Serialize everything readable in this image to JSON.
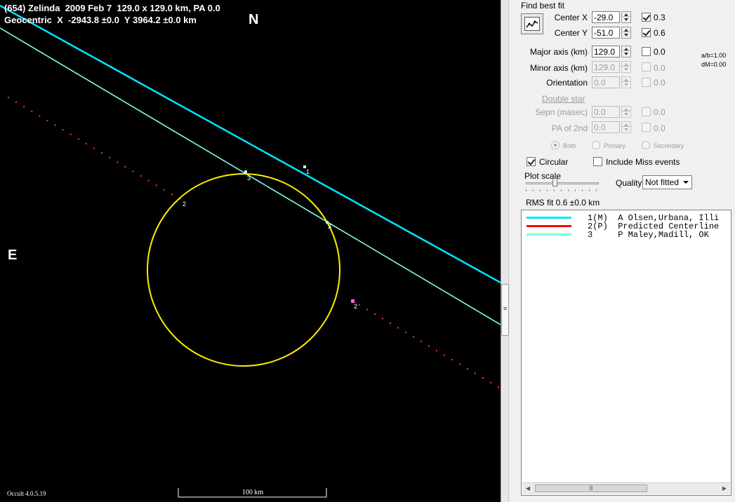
{
  "plot": {
    "title_line1": "(654) Zelinda  2009 Feb 7  129.0 x 129.0 km, PA 0.0",
    "title_line2": "Geocentric  X  -2943.8 ±0.0  Y 3964.2 ±0.0 km",
    "north_label": "N",
    "east_label": "E",
    "version": "Occult 4.0.5.19",
    "scale_label": "100 km",
    "chord_labels": [
      "1",
      "2",
      "3",
      "2",
      "3"
    ],
    "colors": {
      "chord1": "#00e5ff",
      "chord2": "#ff3030",
      "chord3": "#7fffd4",
      "ellipse": "#ffee00",
      "background": "#000000"
    }
  },
  "panel": {
    "group_title": "Find best fit",
    "fit_button_icon": "fit-chart-icon",
    "center_x": {
      "label": "Center X",
      "value": "-29.0",
      "checked": true,
      "uncertainty": "0.3"
    },
    "center_y": {
      "label": "Center Y",
      "value": "-51.0",
      "checked": true,
      "uncertainty": "0.6"
    },
    "major_axis": {
      "label": "Major axis (km)",
      "value": "129.0",
      "checked": false,
      "uncertainty": "0.0"
    },
    "minor_axis": {
      "label": "Minor axis (km)",
      "value": "129.0",
      "checked": false,
      "uncertainty": "0.0"
    },
    "orientation": {
      "label": "Orientation",
      "value": "0.0",
      "checked": false,
      "uncertainty": "0.0"
    },
    "ratio_ab": "a/b=1.00",
    "ratio_dm": "dM=0.00",
    "double_star_label": "Double star",
    "sepn": {
      "label": "Sepn (masec)",
      "value": "0.0",
      "checked": false,
      "uncertainty": "0.0"
    },
    "pa_2nd": {
      "label": "PA of 2nd",
      "value": "0.0",
      "checked": false,
      "uncertainty": "0.0"
    },
    "radio_both": "Both",
    "radio_primary": "Primary",
    "radio_secondary": "Secondary",
    "circular_label": "Circular",
    "circular_checked": true,
    "include_miss_label": "Include Miss events",
    "include_miss_checked": false,
    "plot_scale_label": "Plot scale",
    "quality_label": "Quality",
    "quality_value": "Not fitted",
    "rms_fit": "RMS fit  0.6 ±0.0 km",
    "legend": [
      {
        "text": "1(M)  A Olsen,Urbana, Illi",
        "color": "#00e5ff"
      },
      {
        "text": "2(P)  Predicted Centerline",
        "color": "#ff0000"
      },
      {
        "text": "3     P Maley,Madill, OK",
        "color": "#7fffd4"
      }
    ]
  }
}
